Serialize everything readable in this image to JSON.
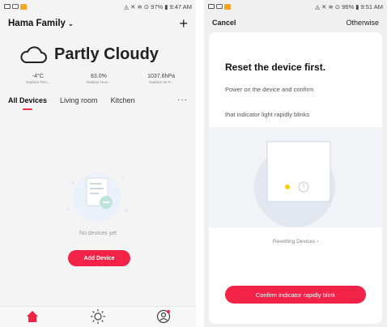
{
  "left_screen": {
    "status": {
      "right": "◬ ✕ ≋ ⊙ 97% ▮ 9:47 AM"
    },
    "header": {
      "home_name": "Hama Family",
      "chevron": "⌄",
      "add_icon": "+"
    },
    "weather": {
      "condition": "Partly Cloudy",
      "icon": "cloud-icon",
      "stats": [
        {
          "value": "-4°C",
          "label": "Outdoor Tem..."
        },
        {
          "value": "83.0%",
          "label": "Outdoor Hum..."
        },
        {
          "value": "1037.6hPa",
          "label": "Outdoor Air P..."
        }
      ]
    },
    "tabs": [
      "All Devices",
      "Living room",
      "Kitchen"
    ],
    "tabs_more": "···",
    "empty_state": {
      "text": "No devices yet",
      "button": "Add Device"
    },
    "bottom_nav": [
      "home-icon",
      "sun-icon",
      "profile-icon"
    ],
    "accent_color": "#f22346"
  },
  "right_screen": {
    "status": {
      "right": "◬ ✕ ≋ ⊙ 96% ▮ 9:51 AM"
    },
    "header": {
      "cancel": "Cancel",
      "otherwise": "Otherwise"
    },
    "card": {
      "title": "Reset the device first.",
      "line1": "Power on the device and confirm",
      "line2": "that indicator light rapidly blinks",
      "resetting_link": "Resetting Devices  ›",
      "confirm_button": "Confirm indicator rapidly blink"
    },
    "indicator_color": "#f5d000"
  }
}
